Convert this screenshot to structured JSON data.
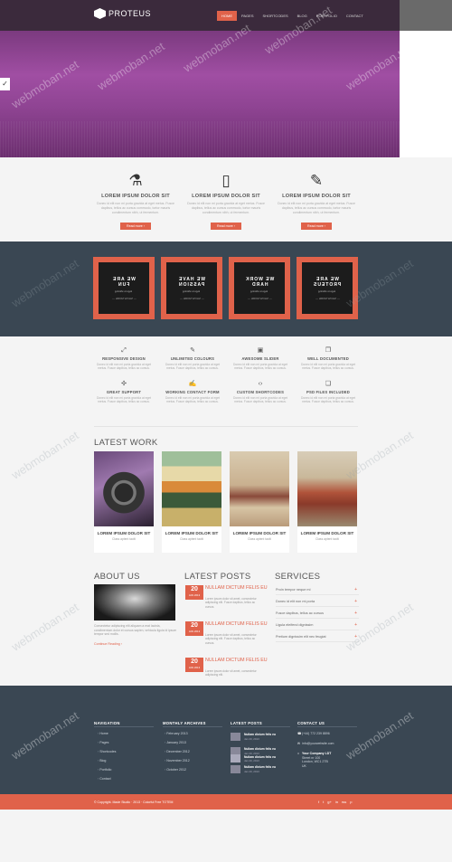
{
  "header": {
    "logo_text": "PROTEUS",
    "nav": [
      "HOME",
      "PAGES",
      "SHORTCODES",
      "BLOG",
      "PORTFOLIO",
      "CONTACT"
    ]
  },
  "hero": {
    "check": "✓"
  },
  "features": [
    {
      "icon": "flask-icon",
      "glyph": "⚗",
      "title": "LOREM IPSUM DOLOR SIT",
      "text": "Donec id elit non mi porta gravida at eget metus. Fusce dapibus, tellus ac cursus commodo, tortor mauris condimentum nibh, ut fermentum.",
      "button": "Read more ›"
    },
    {
      "icon": "tablet-icon",
      "glyph": "▯",
      "title": "LOREM IPSUM DOLOR SIT",
      "text": "Donec id elit non mi porta gravida at eget metus. Fusce dapibus, tellus ac cursus commodo, tortor mauris condimentum nibh, ut fermentum.",
      "button": "Read more ›"
    },
    {
      "icon": "brush-icon",
      "glyph": "✎",
      "title": "LOREM IPSUM DOLOR SIT",
      "text": "Donec id elit non mi porta gravida at eget metus. Fusce dapibus, tellus ac cursus commodo, tortor mauris condimentum nibh, ut fermentum.",
      "button": "Read more ›"
    }
  ],
  "tiles": [
    {
      "t1": "WE ARE",
      "t1b": "FUN",
      "t2": "logo is shining",
      "t3": "— SHOW MORE —"
    },
    {
      "t1": "WE HAVE",
      "t1b": "PASSION",
      "t2": "logo is shining",
      "t3": "— SHOW MORE —"
    },
    {
      "t1": "WE WORK",
      "t1b": "HARD",
      "t2": "logo is shining",
      "t3": "— SHOW MORE —"
    },
    {
      "t1": "WE ARE",
      "t1b": "PROTEUS",
      "t2": "logo is shining",
      "t3": "— SHOW MORE —"
    }
  ],
  "services_grid": [
    {
      "icon": "expand-icon",
      "glyph": "⤢",
      "title": "RESPONSIVE DESIGN",
      "text": "Donec id elit non mi porta gravida at eget metus. Fusce dapibus, tellus ac cursus."
    },
    {
      "icon": "brush-icon",
      "glyph": "✎",
      "title": "UNLIMITED COLOURS",
      "text": "Donec id elit non mi porta gravida at eget metus. Fusce dapibus, tellus ac cursus."
    },
    {
      "icon": "image-icon",
      "glyph": "▣",
      "title": "AWESOME SLIDER",
      "text": "Donec id elit non mi porta gravida at eget metus. Fusce dapibus, tellus ac cursus."
    },
    {
      "icon": "document-icon",
      "glyph": "❐",
      "title": "WELL DOCUMENTED",
      "text": "Donec id elit non mi porta gravida at eget metus. Fusce dapibus, tellus ac cursus."
    },
    {
      "icon": "lifebuoy-icon",
      "glyph": "✣",
      "title": "GREAT SUPPORT",
      "text": "Donec id elit non mi porta gravida at eget metus. Fusce dapibus, tellus ac cursus."
    },
    {
      "icon": "edit-icon",
      "glyph": "✍",
      "title": "WORKING CONTACT FORM",
      "text": "Donec id elit non mi porta gravida at eget metus. Fusce dapibus, tellus ac cursus."
    },
    {
      "icon": "code-icon",
      "glyph": "‹›",
      "title": "CUSTOM SHORTCODES",
      "text": "Donec id elit non mi porta gravida at eget metus. Fusce dapibus, tellus ac cursus."
    },
    {
      "icon": "file-icon",
      "glyph": "❏",
      "title": "PSD FILES INCLUDED",
      "text": "Donec id elit non mi porta gravida at eget metus. Fusce dapibus, tellus ac cursus."
    }
  ],
  "latest_work": {
    "title": "LATEST WORK",
    "items": [
      {
        "title": "LOREM IPSUM DOLOR SIT",
        "sub": "Class aptent taciti"
      },
      {
        "title": "LOREM IPSUM DOLOR SIT",
        "sub": "Class aptent taciti"
      },
      {
        "title": "LOREM IPSUM DOLOR SIT",
        "sub": "Class aptent taciti"
      },
      {
        "title": "LOREM IPSUM DOLOR SIT",
        "sub": "Class aptent taciti"
      }
    ]
  },
  "about": {
    "title": "ABOUT US",
    "text": "Consectetur adipiscing elit aliquam a erat lacinia, condimentum dolor et cursus sapien, vehicula ligula id ipsum tempor sed mollis.",
    "more": "Continue Reading ›"
  },
  "latest_posts": {
    "title": "LATEST POSTS",
    "items": [
      {
        "day": "20",
        "month": "JAN 2013",
        "title": "NULLAM DICTUM FELIS EU",
        "text": "Lorem ipsum dolor sit amet, consectetur adipiscing elit. Fusce dapibus, tellus ac cursus."
      },
      {
        "day": "20",
        "month": "JAN 2013",
        "title": "NULLAM DICTUM FELIS EU",
        "text": "Lorem ipsum dolor sit amet, consectetur adipiscing elit. Fusce dapibus, tellus ac cursus."
      },
      {
        "day": "20",
        "month": "JAN 2013",
        "title": "NULLAM DICTUM FELIS EU",
        "text": "Lorem ipsum dolor sit amet, consectetur adipiscing elit."
      }
    ]
  },
  "services_list": {
    "title": "SERVICES",
    "items": [
      "Proin tempor neque mi",
      "Donec id elit non mi porta",
      "Fusce dapibus, tellus ac cursus",
      "Ligula eleifend dignissim",
      "Pretium dignissim elit nec feugiat"
    ]
  },
  "footer": {
    "navigation": {
      "title": "NAVIGATION",
      "links": [
        "Home",
        "Pages",
        "Shortcodes",
        "Blog",
        "Portfolio",
        "Contact"
      ]
    },
    "archives": {
      "title": "MONTHLY ARCHIVES",
      "links": [
        "February 2013",
        "January 2013",
        "December 2012",
        "November 2012",
        "October 2012"
      ]
    },
    "latest_posts": {
      "title": "LATEST POSTS",
      "items": [
        {
          "title": "Nullam dictum felis eu",
          "date": "Jan 20, 2013"
        },
        {
          "title": "Nullam dictum felis eu",
          "date": "Jan 20, 2013"
        },
        {
          "title": "Nullam dictum felis eu",
          "date": "Jan 20, 2013"
        },
        {
          "title": "Nullam dictum felis eu",
          "date": "Jan 20, 2013"
        }
      ]
    },
    "contact": {
      "title": "CONTACT US",
      "phone": "(+44) 772 239 8896",
      "email": "info@yourwebsite.com",
      "company": "Your Company LDT",
      "address1": "Street nr 100",
      "address2": "London, WC1 2TB",
      "country": "UK"
    },
    "copyright": "© Copyright. Made Studio · 2013 · Colorful Free TOTEM",
    "social": [
      "f",
      "t",
      "g+",
      "in",
      "rss",
      "p"
    ]
  },
  "watermark": "webmoban.net",
  "colors": {
    "accent": "#e0624a",
    "dark": "#3a4753",
    "header": "#3b2a3c",
    "hero": "#a04ea3"
  }
}
